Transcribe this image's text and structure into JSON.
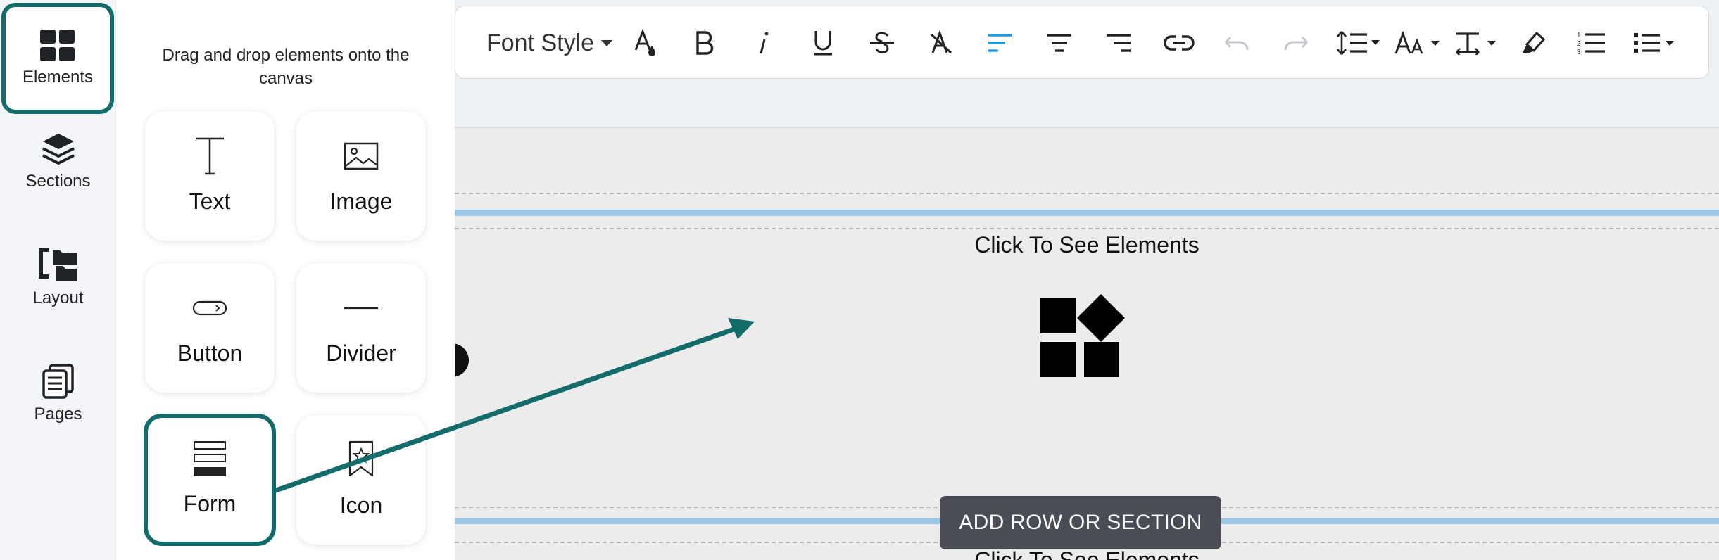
{
  "rail": {
    "items": [
      {
        "label": "Elements",
        "icon": "grid-icon"
      },
      {
        "label": "Sections",
        "icon": "layers-icon"
      },
      {
        "label": "Layout",
        "icon": "layout-tree-icon"
      },
      {
        "label": "Pages",
        "icon": "pages-icon"
      }
    ]
  },
  "panel": {
    "hint": "Drag and drop elements onto the canvas",
    "tiles": [
      {
        "label": "Text",
        "icon": "text-icon"
      },
      {
        "label": "Image",
        "icon": "image-icon"
      },
      {
        "label": "Button",
        "icon": "button-icon"
      },
      {
        "label": "Divider",
        "icon": "divider-icon"
      },
      {
        "label": "Form",
        "icon": "form-icon"
      },
      {
        "label": "Icon",
        "icon": "bookmark-star-icon"
      }
    ]
  },
  "toolbar": {
    "font_style": "Font Style",
    "buttons": [
      "font-color-icon",
      "bold-icon",
      "italic-icon",
      "underline-icon",
      "strikethrough-icon",
      "clear-format-icon",
      "align-left-icon",
      "align-center-icon",
      "align-right-icon",
      "link-icon",
      "undo-icon",
      "redo-icon",
      "line-height-icon",
      "font-size-icon",
      "text-spacing-icon",
      "highlight-icon",
      "ordered-list-icon",
      "unordered-list-icon"
    ],
    "active_color": "#1a9be6"
  },
  "canvas": {
    "section_label": "Click To See Elements",
    "add_row_label": "ADD ROW OR SECTION",
    "accent": "#136c6a",
    "row_line_color": "#9cc5e6"
  }
}
